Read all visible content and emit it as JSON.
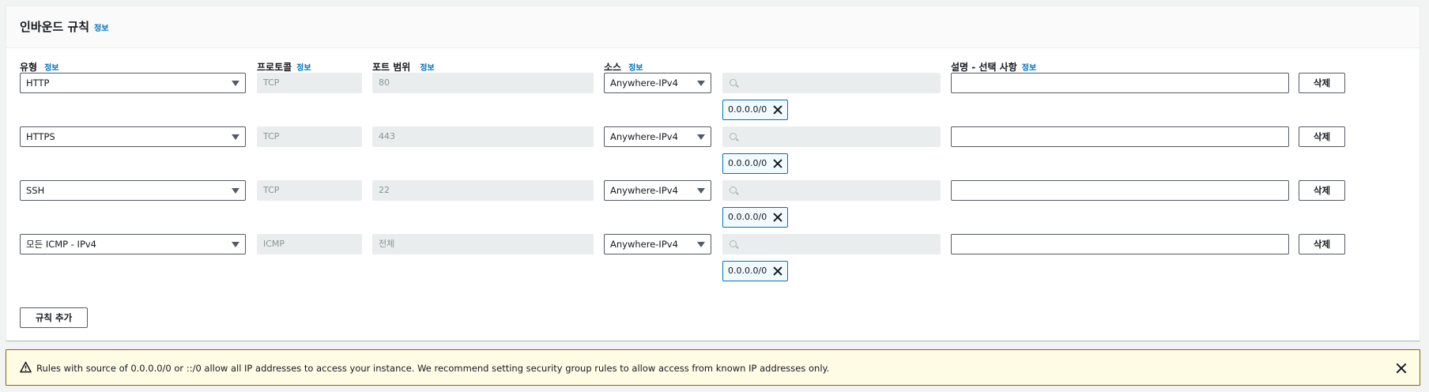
{
  "panel": {
    "title": "인바운드 규칙",
    "info_label": "정보"
  },
  "columns": {
    "type": "유형",
    "protocol": "프로토콜",
    "port_range": "포트 범위",
    "source": "소스",
    "description": "설명 - 선택 사항",
    "info_label": "정보"
  },
  "rules": [
    {
      "type": "HTTP",
      "protocol": "TCP",
      "port_range": "80",
      "source": "Anywhere-IPv4",
      "search_value": "",
      "cidr": "0.0.0.0/0",
      "description": "",
      "delete_label": "삭제"
    },
    {
      "type": "HTTPS",
      "protocol": "TCP",
      "port_range": "443",
      "source": "Anywhere-IPv4",
      "search_value": "",
      "cidr": "0.0.0.0/0",
      "description": "",
      "delete_label": "삭제"
    },
    {
      "type": "SSH",
      "protocol": "TCP",
      "port_range": "22",
      "source": "Anywhere-IPv4",
      "search_value": "",
      "cidr": "0.0.0.0/0",
      "description": "",
      "delete_label": "삭제"
    },
    {
      "type": "모든 ICMP - IPv4",
      "protocol": "ICMP",
      "port_range": "전체",
      "source": "Anywhere-IPv4",
      "search_value": "",
      "cidr": "0.0.0.0/0",
      "description": "",
      "delete_label": "삭제"
    }
  ],
  "add_rule_label": "규칙 추가",
  "warning": {
    "text": "Rules with source of 0.0.0.0/0 or ::/0 allow all IP addresses to access your instance. We recommend setting security group rules to allow access from known IP addresses only.",
    "icon": "warning-triangle-icon",
    "color": "#8d6605"
  },
  "colors": {
    "link": "#0073bb",
    "token_border": "#0073bb",
    "warning_bg": "#fffce6"
  }
}
